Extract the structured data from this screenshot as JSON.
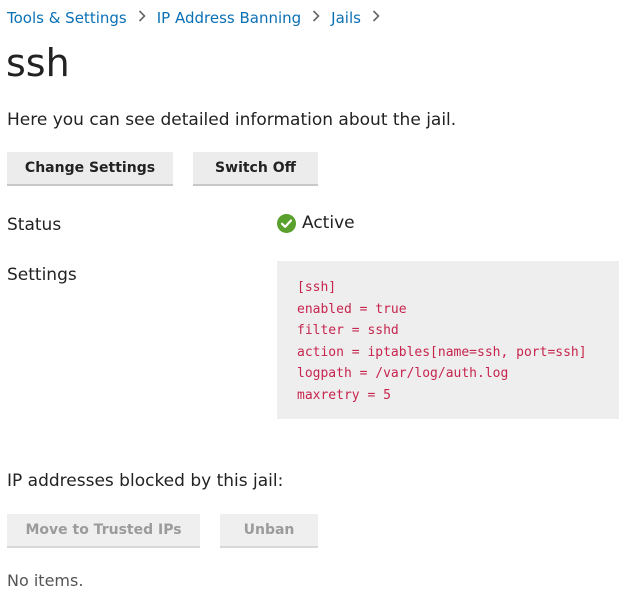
{
  "breadcrumb": {
    "items": [
      "Tools & Settings",
      "IP Address Banning",
      "Jails"
    ],
    "separator_icon": "chevron-right-icon"
  },
  "page": {
    "title": "ssh",
    "description": "Here you can see detailed information about the jail."
  },
  "toolbar": {
    "change_settings_label": "Change Settings",
    "switch_off_label": "Switch Off"
  },
  "details": {
    "status_label": "Status",
    "status_value": "Active",
    "status_icon": "check-circle-icon",
    "status_color": "#5aa02c",
    "settings_label": "Settings",
    "settings_lines": [
      "[ssh]",
      "enabled = true",
      "filter = sshd",
      "action = iptables[name=ssh, port=ssh]",
      "logpath = /var/log/auth.log",
      "maxretry = 5"
    ]
  },
  "blocked": {
    "heading": "IP addresses blocked by this jail:",
    "move_trusted_label": "Move to Trusted IPs",
    "unban_label": "Unban",
    "empty_text": "No items."
  },
  "colors": {
    "link": "#0a70b5",
    "code_text": "#c7254e",
    "code_background": "#eeeeee",
    "button_background": "#ececec"
  }
}
